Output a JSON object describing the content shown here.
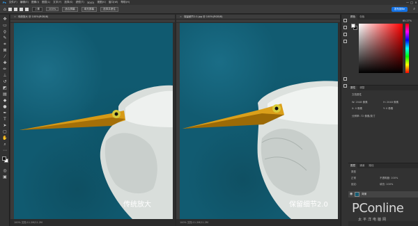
{
  "menubar": {
    "items": [
      "文件(F)",
      "编辑(E)",
      "图像(I)",
      "图层(L)",
      "文字(Y)",
      "选择(S)",
      "滤镜(T)",
      "3D(D)",
      "视图(V)",
      "窗口(W)",
      "帮助(H)"
    ],
    "window_controls": [
      "—",
      "□",
      "×"
    ]
  },
  "optbar": {
    "mode_label": "上置",
    "zoom_label": "100%",
    "fit_label": "适合屏幕",
    "fill_label": "填充屏幕",
    "feedback_label": "选择并遮住",
    "share_label": "发布到Be"
  },
  "documents": {
    "left": {
      "tab_title": "传统放大 @ 100%(RGB/8)",
      "caption": "传统放大",
      "status": "100%   文档:11.2M/11.2M"
    },
    "right": {
      "tab_title": "保留细节2.0.jpg @ 100%(RGB/8)",
      "caption": "保留细节2.0",
      "status": "100%   文档:11.2M/11.2M"
    }
  },
  "panels": {
    "color_tabs": [
      "颜色",
      "色板"
    ],
    "color_readout": "85.27%",
    "properties_tabs": [
      "属性",
      "调整"
    ],
    "properties": {
      "header": "文档属性",
      "w_label": "W: 2048 像素",
      "h_label": "H: 2048 像素",
      "x_label": "X: 0 像素",
      "y_label": "Y: 0 像素",
      "resolution": "分辨率: 72 像素/英寸"
    },
    "layers_tabs": [
      "图层",
      "通道",
      "路径"
    ],
    "layers": {
      "kind_label": "类型",
      "blend_mode": "正常",
      "opacity_label": "不透明度: 100%",
      "lock_label": "锁定:",
      "fill_label": "填充: 100%",
      "layer_name": "背景"
    }
  },
  "watermark": {
    "brand": "PConline",
    "subtitle": "太平洋电脑网"
  },
  "colors": {
    "water": "#105a70",
    "beak": "#e0a81c",
    "bird": "#e8ecea",
    "accent": "#1473e6"
  }
}
